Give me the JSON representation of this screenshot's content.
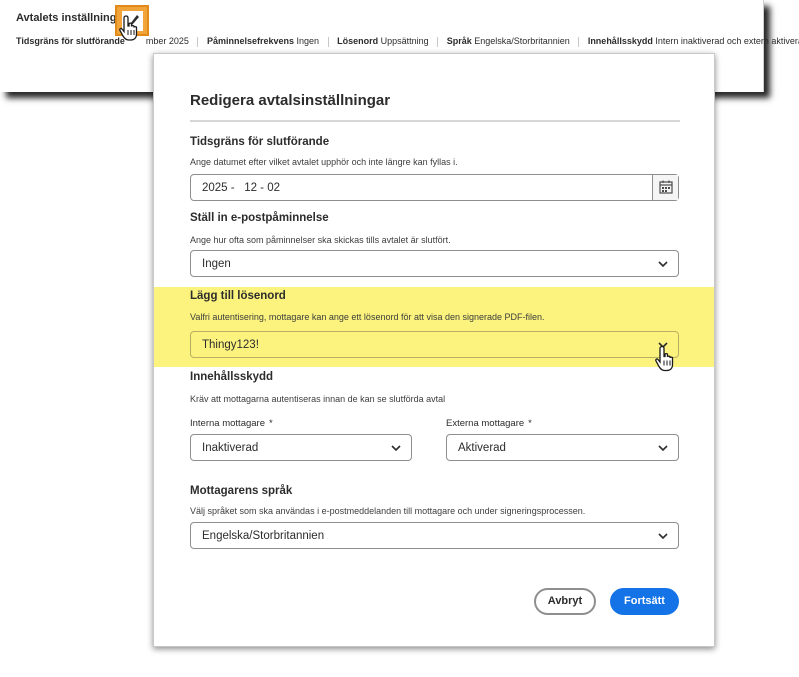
{
  "summary": {
    "title": "Avtalets inställningar",
    "items": [
      {
        "label": "Tidsgräns för slutförande",
        "value": "mber 2025"
      },
      {
        "label": "Påminnelsefrekvens",
        "value": "Ingen"
      },
      {
        "label": "Lösenord",
        "value": "Uppsättning"
      },
      {
        "label": "Språk",
        "value": "Engelska/Storbritannien"
      },
      {
        "label": "Innehållsskydd",
        "value": "Intern inaktiverad och extern aktiverad"
      }
    ]
  },
  "modal": {
    "title": "Redigera avtalsinställningar",
    "deadline": {
      "title": "Tidsgräns för slutförande",
      "description": "Ange datumet efter vilket avtalet upphör och inte längre kan fyllas i.",
      "value": "2025 -   12 - 02"
    },
    "reminder": {
      "title": "Ställ in e-postpåminnelse",
      "description": "Ange hur ofta som påminnelser ska skickas tills avtalet är slutfört.",
      "value": "Ingen"
    },
    "password": {
      "title": "Lägg till lösenord",
      "description": "Valfri autentisering, mottagare kan ange ett lösenord för att visa den signerade PDF-filen.",
      "value": "Thingy123!"
    },
    "protection": {
      "title": "Innehållsskydd",
      "description": "Kräv att mottagarna autentiseras innan de kan se slutförda avtal",
      "internal_label": "Interna mottagare",
      "internal_value": "Inaktiverad",
      "external_label": "Externa mottagare",
      "external_value": "Aktiverad",
      "required_marker": "*"
    },
    "language": {
      "title": "Mottagarens språk",
      "description": "Välj språket som ska användas i e-postmeddelanden till mottagare och under signeringsprocessen.",
      "value": "Engelska/Storbritannien"
    },
    "cancel_label": "Avbryt",
    "continue_label": "Fortsätt"
  },
  "colors": {
    "accent": "#1473e6",
    "highlight": "#fbf37d",
    "edit_button": "#f2a33a"
  },
  "icons": {
    "edit": "pencil-icon",
    "calendar": "calendar-icon",
    "dropdown": "chevron-down-icon",
    "pointer": "hand-cursor-icon"
  }
}
